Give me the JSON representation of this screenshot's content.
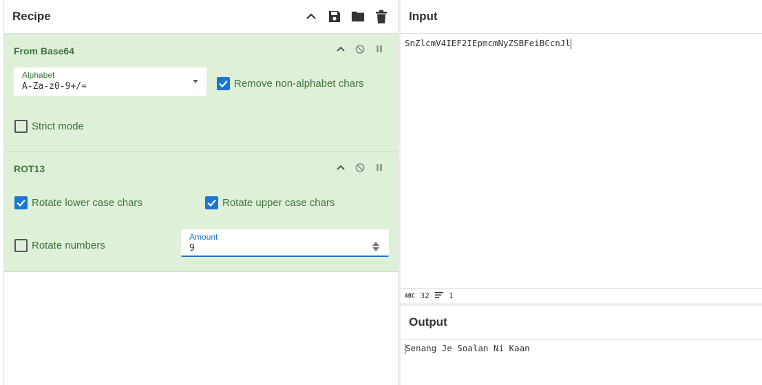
{
  "recipe": {
    "title": "Recipe",
    "icons": [
      "chevron-up-icon",
      "save-icon",
      "folder-icon",
      "trash-icon"
    ]
  },
  "ops": {
    "from_base64": {
      "title": "From Base64",
      "alphabet_label": "Alphabet",
      "alphabet_value": "A-Za-z0-9+/=",
      "remove_non_alpha_label": "Remove non-alphabet chars",
      "remove_non_alpha_checked": true,
      "strict_mode_label": "Strict mode",
      "strict_mode_checked": false
    },
    "rot13": {
      "title": "ROT13",
      "rotate_lower_label": "Rotate lower case chars",
      "rotate_lower_checked": true,
      "rotate_upper_label": "Rotate upper case chars",
      "rotate_upper_checked": true,
      "rotate_numbers_label": "Rotate numbers",
      "rotate_numbers_checked": false,
      "amount_label": "Amount",
      "amount_value": "9"
    }
  },
  "input": {
    "title": "Input",
    "text": "SnZlcmV4IEF2IEpmcmNyZSBFeiBCcnJl",
    "length": "32",
    "lines": "1"
  },
  "output": {
    "title": "Output",
    "text": "Senang Je Soalan Ni Kaan"
  },
  "colors": {
    "op_bg": "#dff0d8",
    "op_text": "#3c763d",
    "accent": "#1976d2"
  }
}
